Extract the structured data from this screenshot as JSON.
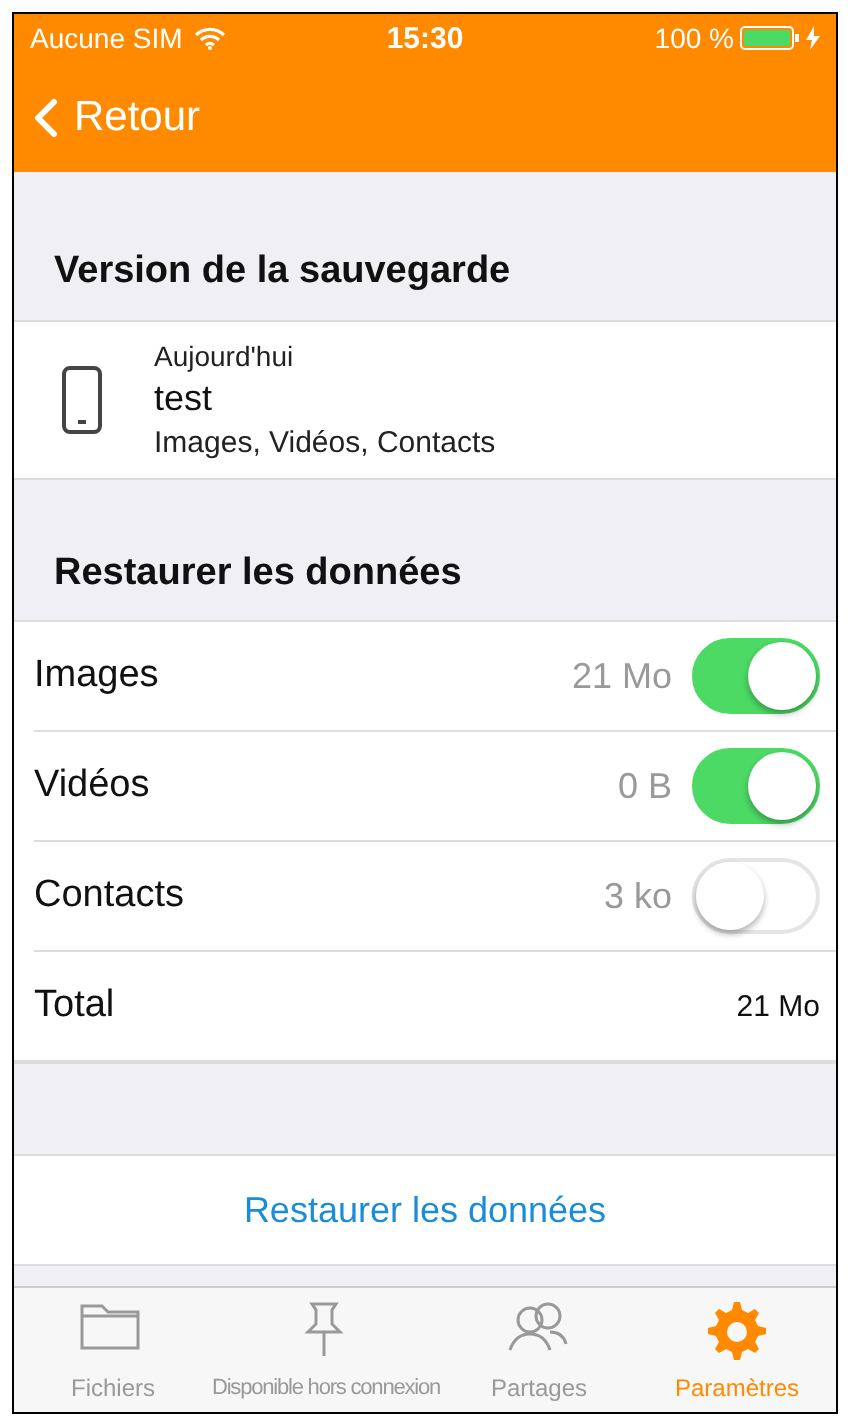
{
  "status_bar": {
    "carrier": "Aucune SIM",
    "time": "15:30",
    "battery": "100 %"
  },
  "nav": {
    "back": "Retour"
  },
  "backup_section": {
    "title": "Version de la sauvegarde",
    "item": {
      "date": "Aujourd'hui",
      "name": "test",
      "contents": "Images, Vidéos, Contacts"
    }
  },
  "restore_section": {
    "title": "Restaurer les données",
    "rows": [
      {
        "kind": "toggle",
        "label": "Images",
        "size": "21 Mo",
        "on": true
      },
      {
        "kind": "toggle",
        "label": "Vidéos",
        "size": "0 B",
        "on": true
      },
      {
        "kind": "toggle",
        "label": "Contacts",
        "size": "3 ko",
        "on": false
      },
      {
        "kind": "total",
        "label": "Total",
        "size": "21 Mo"
      }
    ]
  },
  "restore_button": "Restaurer les données",
  "tabs": [
    {
      "label": "Fichiers",
      "selected": false
    },
    {
      "label": "Disponible hors connexion",
      "selected": false
    },
    {
      "label": "Partages",
      "selected": false
    },
    {
      "label": "Paramètres",
      "selected": true
    }
  ]
}
